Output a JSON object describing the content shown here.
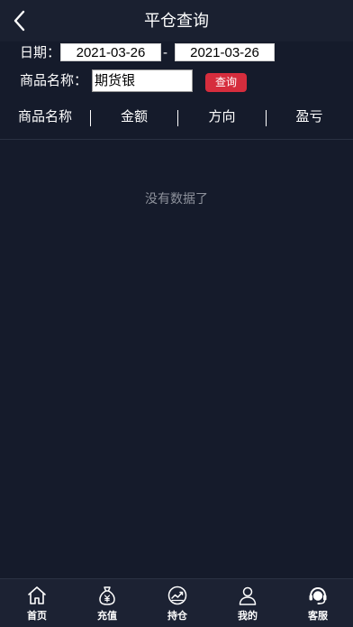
{
  "header": {
    "title": "平仓查询",
    "back_icon": "chevron-left-icon"
  },
  "filters": {
    "date_label": "日期：",
    "date_start": "2021-03-26",
    "date_separator": "-",
    "date_end": "2021-03-26",
    "product_label": "商品名称：",
    "product_value": "期货银",
    "query_button": "查询"
  },
  "table": {
    "columns": [
      "商品名称",
      "金额",
      "方向",
      "盈亏"
    ],
    "rows": [],
    "empty_message": "没有数据了"
  },
  "tabbar": {
    "items": [
      {
        "label": "首页",
        "icon": "home-icon"
      },
      {
        "label": "充值",
        "icon": "money-bag-icon"
      },
      {
        "label": "持仓",
        "icon": "chart-trend-icon"
      },
      {
        "label": "我的",
        "icon": "user-icon"
      },
      {
        "label": "客服",
        "icon": "headset-icon"
      }
    ]
  },
  "colors": {
    "background": "#151b2b",
    "header": "#1a2030",
    "accent": "#d62d3d",
    "muted_text": "#8e929c"
  }
}
